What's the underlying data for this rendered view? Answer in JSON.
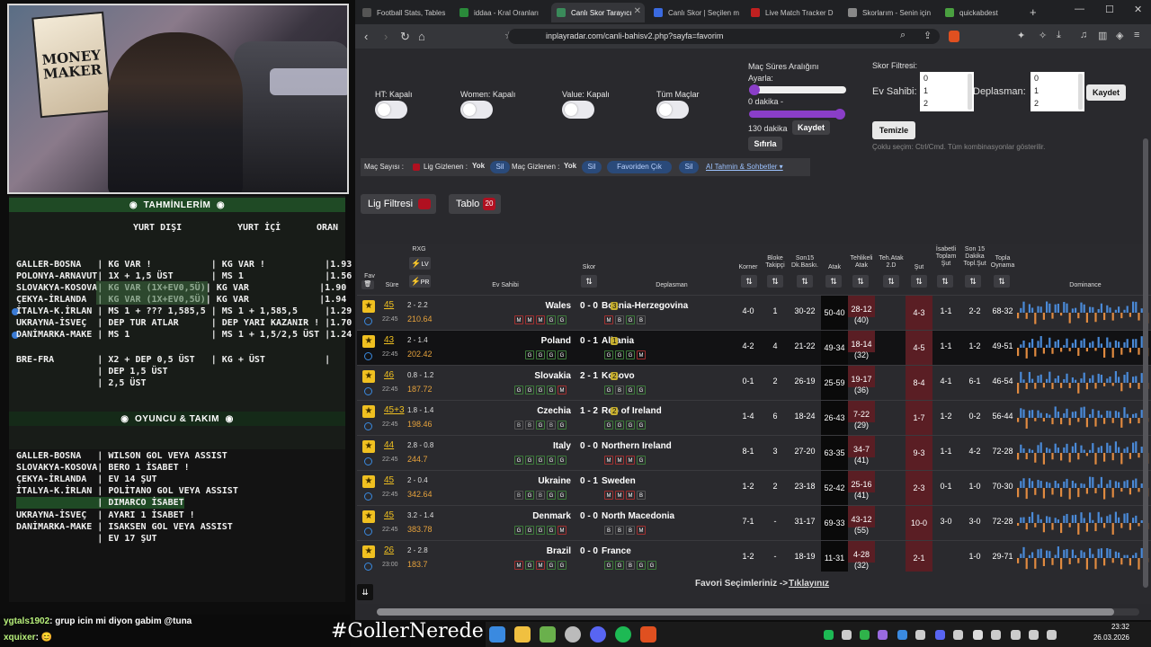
{
  "webcam": {
    "poster_text": "MONEY MAKER"
  },
  "tahmin": {
    "title": "TAHMİNLERİM",
    "col_yurtdisi": "YURT DIŞI",
    "col_yurtici": "YURT İÇİ",
    "col_oran": "ORAN",
    "rows": [
      "GALLER-BOSNA   | KG VAR !           | KG VAR !           |1.93",
      "POLONYA-ARNAVUT| 1X + 1,5 ÜST       | MS 1               |1.56",
      "SLOVAKYA-KOSOVA| KG VAR (1X+EV0,5Ü)| KG VAR             |1.90",
      "ÇEKYA-İRLANDA  | KG VAR (1X+EV0,5Ü)| KG VAR             |1.94",
      "İTALYA-K.İRLAN | MS 1 + ??? 1,585,5 | MS 1 + 1,585,5     |1.29",
      "UKRAYNA-İSVEÇ  | DEP TUR ATLAR      | DEP YARI KAZANIR ! |1.70",
      "DANİMARKA-MAKE | MS 1               | MS 1 + 1,5/2,5 ÜST |1.24"
    ],
    "extra": [
      "BRE-FRA        | X2 + DEP 0,5 ÜST   | KG + ÜST           |",
      "               | DEP 1,5 ÜST",
      "               | 2,5 ÜST"
    ]
  },
  "oyuncu": {
    "title": "OYUNCU & TAKIM",
    "rows": [
      "GALLER-BOSNA   | WILSON GOL VEYA ASSIST",
      "SLOVAKYA-KOSOVA| BERO 1 İSABET !",
      "ÇEKYA-İRLANDA  | EV 14 ŞUT",
      "İTALYA-K.İRLAN | POLİTANO GOL VEYA ASSIST",
      "               | DIMARCO İSABET",
      "UKRAYNA-İSVEÇ  | AYARI 1 İSABET !",
      "DANİMARKA-MAKE | ISAKSEN GOL VEYA ASSIST",
      "               | EV 17 ŞUT"
    ]
  },
  "chat": [
    {
      "user": "ygtals1902",
      "msg": ": grup icin mi diyon gabim @tuna"
    },
    {
      "user": "xquixer",
      "msg": ": 😊"
    }
  ],
  "hashtag": "#GollerNerede",
  "taskbar": {
    "time": "23:32",
    "date": "26.03.2026"
  },
  "browser": {
    "tabs": [
      "Football Stats, Tables",
      "iddaa - Kral Oranları",
      "Canlı Skor Tarayıcı",
      "Canlı Skor | Seçilen m",
      "Live Match Tracker D",
      "Skorlarım - Senin için",
      "quickabdest"
    ],
    "url": "inplayradar.com/canli-bahisv2.php?sayfa=favorim"
  },
  "filters": {
    "ht": "HT: Kapalı",
    "women": "Women: Kapalı",
    "value": "Value: Kapalı",
    "tum": "Tüm Maçlar",
    "sure_title": "Maç Süres Aralığını Ayarla:",
    "dakika0": "0 dakika -",
    "dakika130": "130 dakika",
    "kaydet": "Kaydet",
    "sifirla": "Sıfırla",
    "skor_title": "Skor Filtresi:",
    "ev": "Ev Sahibi:",
    "dep": "Deplasman:",
    "opts": [
      "0",
      "1",
      "2"
    ],
    "kaydet2": "Kaydet",
    "temizle": "Temizle",
    "coklu": "Çoklu seçim: Ctrl/Cmd. Tüm kombinasyonlar gösterilir."
  },
  "favbar": {
    "mac": "Maç Sayısı :",
    "lig_gizlenen": "Lig Gizlenen :",
    "yok": "Yok",
    "sil": "Sil",
    "mac_gizlenen": "Maç Gizlenen :",
    "favoriden": "Favoriden Çık",
    "ai": "AI Tahmin & Sohbetler ▾"
  },
  "lig_filtresi": "Lig Filtresi",
  "tablo": "Tablo",
  "tablo_count": "20",
  "headers": {
    "fav": "Fav",
    "sure": "Süre",
    "rxg": "RXG",
    "lv": "LV",
    "pr": "PR",
    "ev": "Ev Sahibi",
    "skor": "Skor",
    "dep": "Deplasman",
    "korner": "Korner",
    "bloke": "Bloke Takipçi",
    "son15": "Son15 Dk.Baskı.",
    "atak": "Atak",
    "tehlikeli": "Tehlikeli Atak",
    "tehatak2d": "Teh.Atak 2.D",
    "sut": "Şut",
    "isabetli": "İsabetli Toplam Şut",
    "son15dk": "Son 15 Dakika Topl.Şut",
    "topla": "Topla Oynama",
    "dominance": "Dominance"
  },
  "matches": [
    {
      "min": "45",
      "ko": "22:45",
      "xg": "2 - 2.2",
      "pres": "210.64",
      "home": "Wales",
      "score": "0 - 0",
      "away": "Bosnia-Herzegovina",
      "away_badge": "3",
      "hf": [
        "M",
        "M",
        "M",
        "G",
        "G"
      ],
      "af": [
        "M",
        "B",
        "G",
        "B"
      ],
      "korner": "4-0",
      "bloke": "1",
      "s15": "30-22",
      "atak": "50-40",
      "teh": "28-12",
      "teh2": "(40)",
      "sut": "4-3",
      "isa": "1-1",
      "s15s": "2-2",
      "topla": "68-32"
    },
    {
      "min": "43",
      "ko": "22:45",
      "xg": "2 - 1.4",
      "pres": "202.42",
      "home": "Poland",
      "score": "0 - 1",
      "away": "Albania",
      "away_badge": "1",
      "hf": [
        "G",
        "G",
        "G",
        "G"
      ],
      "af": [
        "G",
        "G",
        "G",
        "M"
      ],
      "korner": "4-2",
      "bloke": "4",
      "s15": "21-22",
      "atak": "49-34",
      "teh": "18-14",
      "teh2": "(32)",
      "sut": "4-5",
      "isa": "1-1",
      "s15s": "1-2",
      "topla": "49-51"
    },
    {
      "min": "46",
      "ko": "22:45",
      "xg": "0.8 - 1.2",
      "pres": "187.72",
      "home": "Slovakia",
      "score": "2 - 1",
      "away": "Kosovo",
      "away_badge": "2",
      "hf": [
        "G",
        "G",
        "G",
        "G",
        "M"
      ],
      "af": [
        "G",
        "B",
        "G",
        "G"
      ],
      "korner": "0-1",
      "bloke": "2",
      "s15": "26-19",
      "atak": "25-59",
      "teh": "19-17",
      "teh2": "(36)",
      "sut": "8-4",
      "isa": "4-1",
      "s15s": "6-1",
      "topla": "46-54"
    },
    {
      "min": "45+3",
      "ko": "22:45",
      "xg": "1.8 - 1.4",
      "pres": "198.46",
      "home": "Czechia",
      "score": "1 - 2",
      "away": "Rep of Ireland",
      "away_badge": "2",
      "hf": [
        "B",
        "B",
        "G",
        "B",
        "G"
      ],
      "af": [
        "G",
        "G",
        "G",
        "G"
      ],
      "korner": "1-4",
      "bloke": "6",
      "s15": "18-24",
      "atak": "26-43",
      "teh": "7-22",
      "teh2": "(29)",
      "sut": "1-7",
      "isa": "1-2",
      "s15s": "0-2",
      "topla": "56-44"
    },
    {
      "min": "44",
      "ko": "22:45",
      "xg": "2.8 - 0.8",
      "pres": "244.7",
      "home": "Italy",
      "score": "0 - 0",
      "away": "Northern Ireland",
      "away_badge": "",
      "hf": [
        "G",
        "G",
        "G",
        "G",
        "G"
      ],
      "af": [
        "M",
        "M",
        "M",
        "G"
      ],
      "korner": "8-1",
      "bloke": "3",
      "s15": "27-20",
      "atak": "63-35",
      "teh": "34-7",
      "teh2": "(41)",
      "sut": "9-3",
      "isa": "1-1",
      "s15s": "4-2",
      "topla": "72-28"
    },
    {
      "min": "45",
      "ko": "22:45",
      "xg": "2 - 0.4",
      "pres": "342.64",
      "home": "Ukraine",
      "score": "0 - 1",
      "away": "Sweden",
      "away_badge": "",
      "hf": [
        "B",
        "G",
        "B",
        "G",
        "G"
      ],
      "af": [
        "M",
        "M",
        "M",
        "B"
      ],
      "korner": "1-2",
      "bloke": "2",
      "s15": "23-18",
      "atak": "52-42",
      "teh": "25-16",
      "teh2": "(41)",
      "sut": "2-3",
      "isa": "0-1",
      "s15s": "1-0",
      "topla": "70-30"
    },
    {
      "min": "45",
      "ko": "22:45",
      "xg": "3.2 - 1.4",
      "pres": "383.78",
      "home": "Denmark",
      "score": "0 - 0",
      "away": "North Macedonia",
      "away_badge": "",
      "hf": [
        "G",
        "G",
        "G",
        "G",
        "M"
      ],
      "af": [
        "B",
        "B",
        "B",
        "M"
      ],
      "korner": "7-1",
      "bloke": "-",
      "s15": "31-17",
      "atak": "69-33",
      "teh": "43-12",
      "teh2": "(55)",
      "sut": "10-0",
      "isa": "3-0",
      "s15s": "3-0",
      "topla": "72-28"
    },
    {
      "min": "26",
      "ko": "23:00",
      "xg": "2 - 2.8",
      "pres": "183.7",
      "home": "Brazil",
      "score": "0 - 0",
      "away": "France",
      "away_badge": "",
      "hf": [
        "M",
        "G",
        "M",
        "G",
        "G"
      ],
      "af": [
        "G",
        "G",
        "B",
        "G",
        "G"
      ],
      "korner": "1-2",
      "bloke": "-",
      "s15": "18-19",
      "atak": "11-31",
      "teh": "4-28",
      "teh2": "(32)",
      "sut": "2-1",
      "isa": "",
      "s15s": "1-0",
      "topla": "29-71"
    }
  ],
  "favori_text": "Favori Seçimleriniz ->",
  "tiklayiniz": "Tıklayınız"
}
